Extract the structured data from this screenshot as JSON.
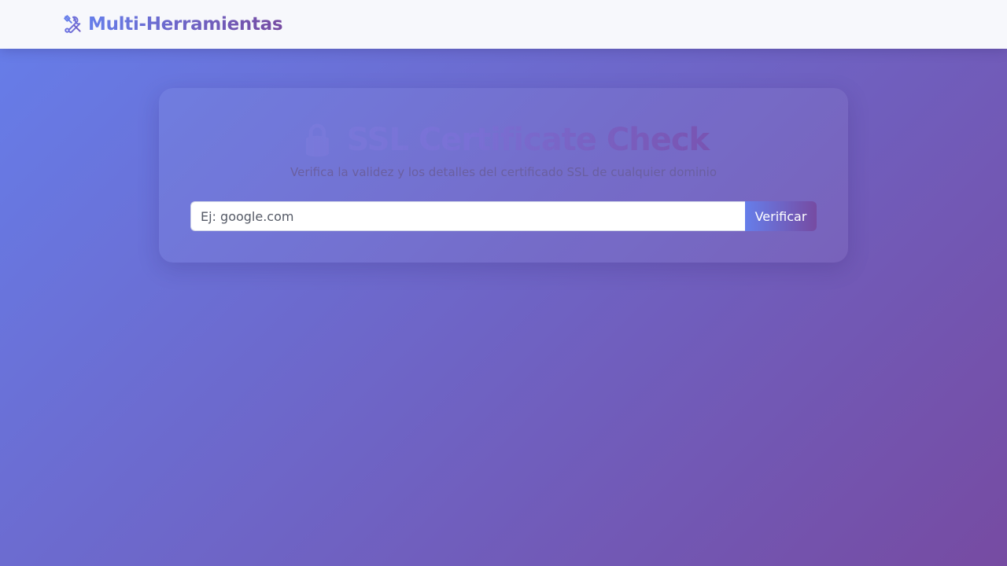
{
  "navbar": {
    "brand_text": "Multi-Herramientas",
    "brand_icon": "tools-icon"
  },
  "card": {
    "title": "🔒 SSL Certificate Check",
    "subtitle": "Verifica la validez y los detalles del certificado SSL de cualquier dominio",
    "search": {
      "placeholder": "Ej: google.com",
      "value": ""
    },
    "button_label": "Verificar"
  },
  "colors": {
    "gradient_start": "#667eea",
    "gradient_end": "#764ba2",
    "navbar_bg": "#f7f8fc"
  }
}
